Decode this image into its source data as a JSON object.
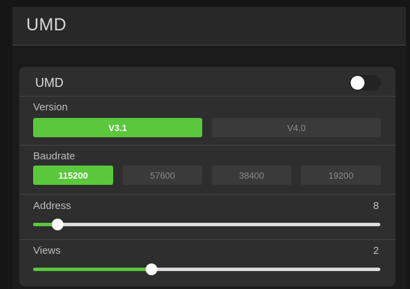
{
  "header": {
    "title": "UMD"
  },
  "umd": {
    "label": "UMD",
    "enabled": false
  },
  "version": {
    "label": "Version",
    "options": [
      "V3.1",
      "V4.0"
    ],
    "selected": "V3.1"
  },
  "baudrate": {
    "label": "Baudrate",
    "options": [
      "115200",
      "57600",
      "38400",
      "19200"
    ],
    "selected": "115200"
  },
  "address": {
    "label": "Address",
    "value": "8",
    "level": 0.07
  },
  "views": {
    "label": "Views",
    "value": "2",
    "level": 0.34
  },
  "colors": {
    "accent": "#5ac73c",
    "panel": "#2e2e2e",
    "background": "#161616"
  }
}
